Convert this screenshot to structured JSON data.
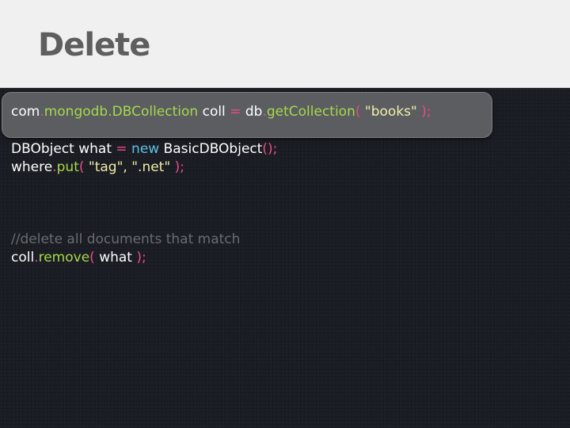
{
  "slide": {
    "title": "Delete"
  },
  "code": {
    "line1": {
      "t1": "com",
      "t2": ".",
      "t3": "mongodb.DBCollection",
      "t4": " coll ",
      "t5": "=",
      "t6": " db",
      "t7": ".",
      "t8": "getCollection",
      "t9": "(",
      "t10": " \"books\" ",
      "t11": ");"
    },
    "line2": {
      "t1": "DBObject what ",
      "t2": "=",
      "t3": " ",
      "t4": "new",
      "t5": " BasicDBObject",
      "t6": "();"
    },
    "line3": {
      "t1": "where",
      "t2": ".",
      "t3": "put",
      "t4": "(",
      "t5": " \"tag\", \".net\" ",
      "t6": ");"
    },
    "line4": {
      "t1": "//",
      "t2": "delete all documents that match"
    },
    "line5": {
      "t1": "coll",
      "t2": ".",
      "t3": "remove",
      "t4": "(",
      "t5": " what ",
      "t6": ");"
    }
  },
  "colors": {
    "header_bg": "#f0f0f0",
    "title": "#5e5e5e",
    "code_bg": "#1b1d24",
    "highlight_bg": "#5b5d61",
    "plain": "#ffffff",
    "accent": "#a6d94a",
    "punctuation": "#ee4a86",
    "string": "#f2eda8",
    "keyword": "#5cc3e6",
    "comment": "#6a6c70"
  }
}
